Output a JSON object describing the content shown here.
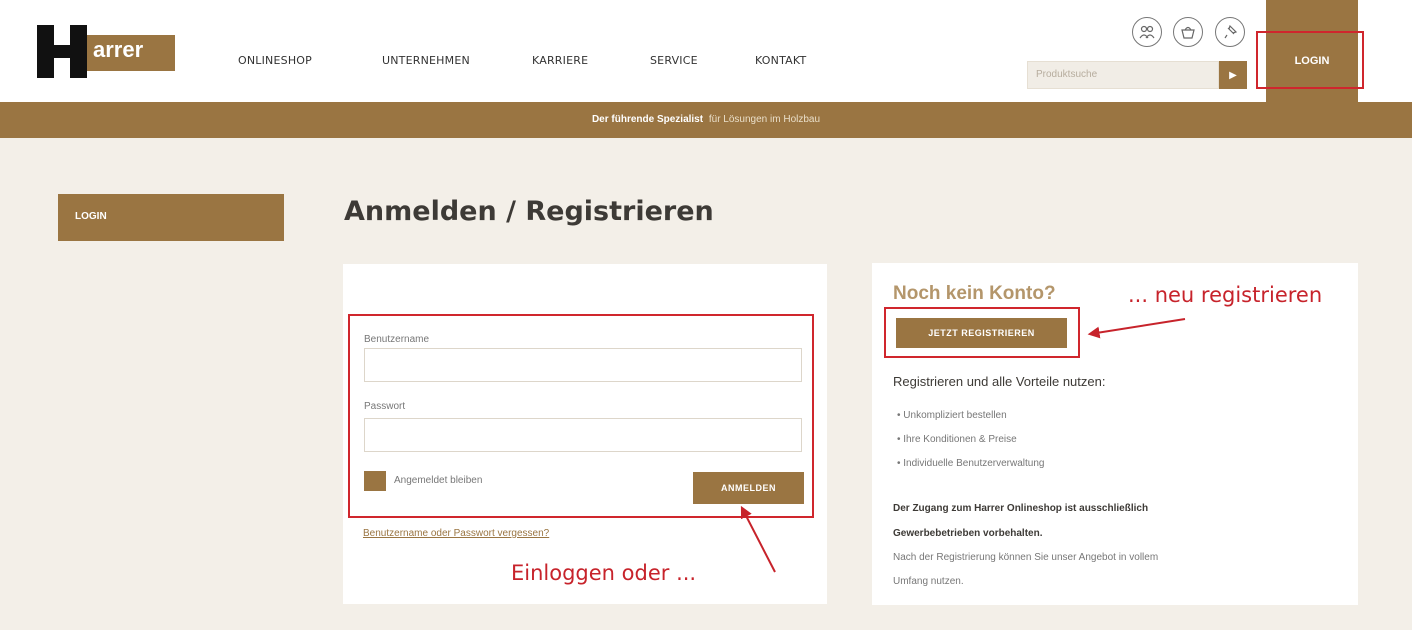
{
  "logo": {
    "text": "arrer",
    "letter": "H"
  },
  "nav": [
    "ONLINESHOP",
    "UNTERNEHMEN",
    "KARRIERE",
    "SERVICE",
    "KONTAKT"
  ],
  "header_icons": [
    "user-group-icon",
    "basket-icon",
    "pin-icon"
  ],
  "search": {
    "placeholder": "Produktsuche",
    "button_icon": "play-icon"
  },
  "login_top": "LOGIN",
  "banner": {
    "bold": "Der führende Spezialist",
    "rest": "für Lösungen im Holzbau"
  },
  "sidebar": {
    "item": "LOGIN"
  },
  "page_title": "Anmelden / Registrieren",
  "login_form": {
    "username_label": "Benutzername",
    "password_label": "Passwort",
    "stay_label": "Angemeldet bleiben",
    "submit": "ANMELDEN",
    "forgot": "Benutzername oder Passwort vergessen?"
  },
  "register": {
    "heading": "Noch kein Konto?",
    "button": "JETZT REGISTRIEREN",
    "benefits_heading": "Registrieren und alle Vorteile nutzen:",
    "benefits": [
      "Unkompliziert bestellen",
      "Ihre Konditionen & Preise",
      "Individuelle Benutzerverwaltung"
    ],
    "note_bold_1": "Der Zugang zum Harrer Onlineshop ist ausschließlich",
    "note_bold_2": "Gewerbebetrieben vorbehalten.",
    "note_1": "Nach der Registrierung können Sie unser Angebot in vollem",
    "note_2": "Umfang nutzen."
  },
  "annotations": {
    "register": "... neu registrieren",
    "login": "Einloggen oder ..."
  },
  "colors": {
    "brand": "#9a7542",
    "annotation": "#d0262d",
    "background": "#f3efe8"
  }
}
